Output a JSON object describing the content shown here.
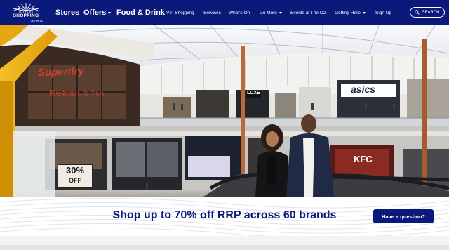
{
  "logo": {
    "line1": "OUTLET",
    "line2": "SHOPPING",
    "line3": "at The O2"
  },
  "nav": {
    "stores": "Stores",
    "offers": "Offers",
    "food_drink": "Food & Drink",
    "vip": "VIP Shopping",
    "services": "Services",
    "whats_on": "What's On",
    "do_more": "Do More",
    "events": "Events at The O2",
    "getting_here": "Getting Here",
    "sign_up": "Sign Up"
  },
  "search": {
    "label": "SEARCH"
  },
  "hero": {
    "signs": {
      "superdry": "Superdry",
      "superdry_jp": "極度乾燥(しなさい)",
      "luxe": "LUXE",
      "asics": "asics",
      "kfc": "KFC",
      "sale_pct": "30%",
      "sale_off": "OFF"
    }
  },
  "promo": {
    "headline": "Shop up to 70% off RRP across 60 brands",
    "question_button": "Have a question?"
  },
  "colors": {
    "brand_navy": "#0b1a7a",
    "mall_yellow": "#f2b111"
  }
}
